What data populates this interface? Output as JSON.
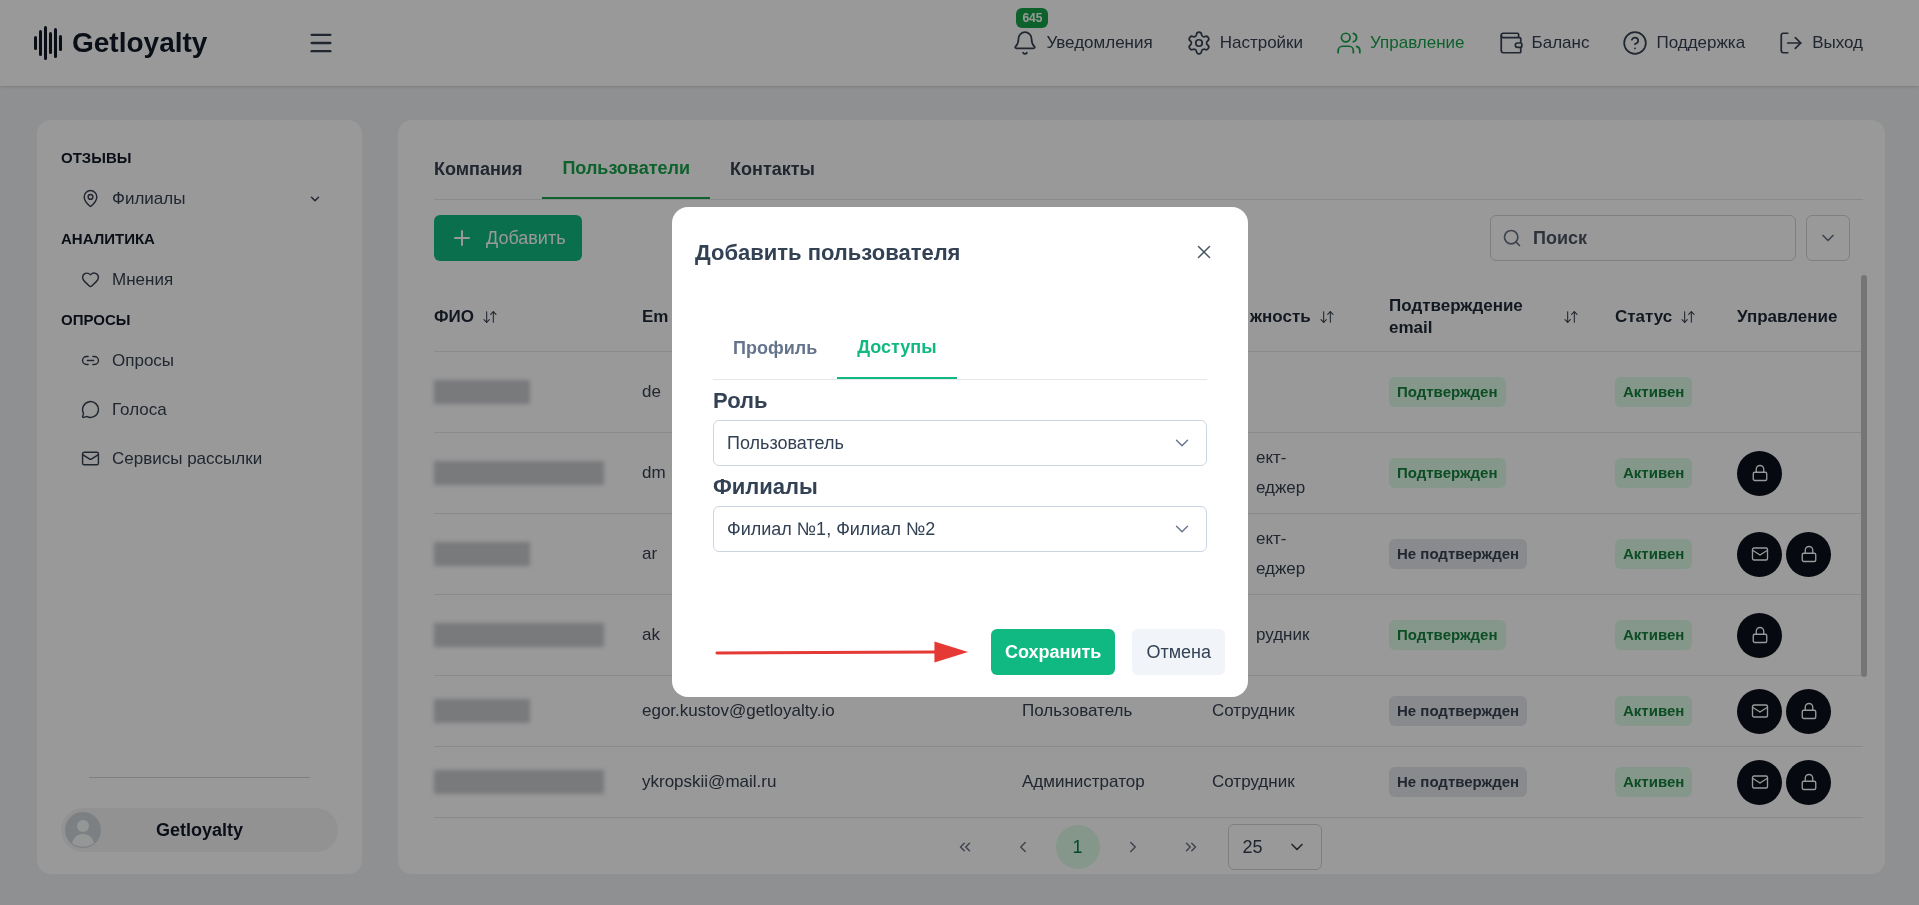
{
  "header": {
    "logo": "Getloyalty",
    "nav": [
      {
        "label": "Уведомления",
        "badge": "645",
        "selected": false
      },
      {
        "label": "Настройки",
        "selected": false
      },
      {
        "label": "Управление",
        "selected": true
      },
      {
        "label": "Баланс",
        "selected": false
      },
      {
        "label": "Поддержка",
        "selected": false
      },
      {
        "label": "Выход",
        "selected": false
      }
    ]
  },
  "sidebar": {
    "sections": [
      {
        "title": "ОТЗЫВЫ",
        "items": [
          {
            "label": "Филиалы",
            "expandable": true
          }
        ]
      },
      {
        "title": "АНАЛИТИКА",
        "items": [
          {
            "label": "Мнения",
            "expandable": false
          }
        ]
      },
      {
        "title": "ОПРОСЫ",
        "items": [
          {
            "label": "Опросы",
            "expandable": false
          },
          {
            "label": "Голоса",
            "expandable": false
          },
          {
            "label": "Сервисы рассылки",
            "expandable": false
          }
        ]
      }
    ],
    "user": {
      "name": "Getloyalty"
    }
  },
  "tabs": [
    {
      "label": "Компания",
      "selected": false
    },
    {
      "label": "Пользователи",
      "selected": true
    },
    {
      "label": "Контакты",
      "selected": false
    }
  ],
  "add_button": "Добавить",
  "search": {
    "placeholder": "Поиск"
  },
  "table": {
    "columns": [
      {
        "label": "ФИО",
        "sortable": true
      },
      {
        "label": "Em"
      },
      {
        "label": "жность",
        "sortable": true
      },
      {
        "label": "Подтверждение email",
        "sortable": true
      },
      {
        "label": "Статус",
        "sortable": true
      },
      {
        "label": "Управление",
        "sortable": false
      }
    ],
    "rows": [
      {
        "email": "de",
        "position": [],
        "confirmation": {
          "label": "Подтвержден",
          "confirmed": true
        },
        "status": "Активен",
        "actions": []
      },
      {
        "covered": true,
        "email": "dm",
        "position": [
          "ект-",
          "еджер"
        ],
        "confirmation": {
          "label": "Подтвержден",
          "confirmed": true
        },
        "status": "Активен",
        "actions": [
          {
            "kind": "lock"
          }
        ]
      },
      {
        "covered": true,
        "email": "ar",
        "position": [
          "ект-",
          "еджер"
        ],
        "confirmation": {
          "label": "Не подтвержден",
          "confirmed": false
        },
        "status": "Активен",
        "actions": [
          {
            "kind": "mail"
          },
          {
            "kind": "lock"
          }
        ]
      },
      {
        "covered": true,
        "email": "ak",
        "position": [
          "рудник"
        ],
        "confirmation": {
          "label": "Подтвержден",
          "confirmed": true
        },
        "status": "Активен",
        "actions": [
          {
            "kind": "lock"
          }
        ]
      },
      {
        "email": "egor.kustov@getloyalty.io",
        "role": "Пользователь",
        "position": [
          "Сотрудник"
        ],
        "confirmation": {
          "label": "Не подтвержден",
          "confirmed": false
        },
        "status": "Активен",
        "actions": [
          {
            "kind": "mail"
          },
          {
            "kind": "lock"
          }
        ]
      },
      {
        "email": "ykropskii@mail.ru",
        "role": "Администратор",
        "position": [
          "Сотрудник"
        ],
        "confirmation": {
          "label": "Не подтвержден",
          "confirmed": false
        },
        "status": "Активен",
        "actions": [
          {
            "kind": "mail"
          },
          {
            "kind": "lock"
          }
        ]
      }
    ]
  },
  "pagination": {
    "pages": [
      {
        "label": "1",
        "selected": true
      }
    ],
    "page_size": "25"
  },
  "modal": {
    "title": "Добавить пользователя",
    "tabs": [
      {
        "label": "Профиль",
        "selected": false
      },
      {
        "label": "Доступы",
        "selected": true
      }
    ],
    "fields": [
      {
        "label": "Роль",
        "value": "Пользователь"
      },
      {
        "label": "Филиалы",
        "value": "Филиал №1, Филиал №2"
      }
    ],
    "buttons": [
      {
        "label": "Сохранить",
        "kind": "primary"
      },
      {
        "label": "Отмена",
        "kind": "secondary"
      }
    ]
  }
}
